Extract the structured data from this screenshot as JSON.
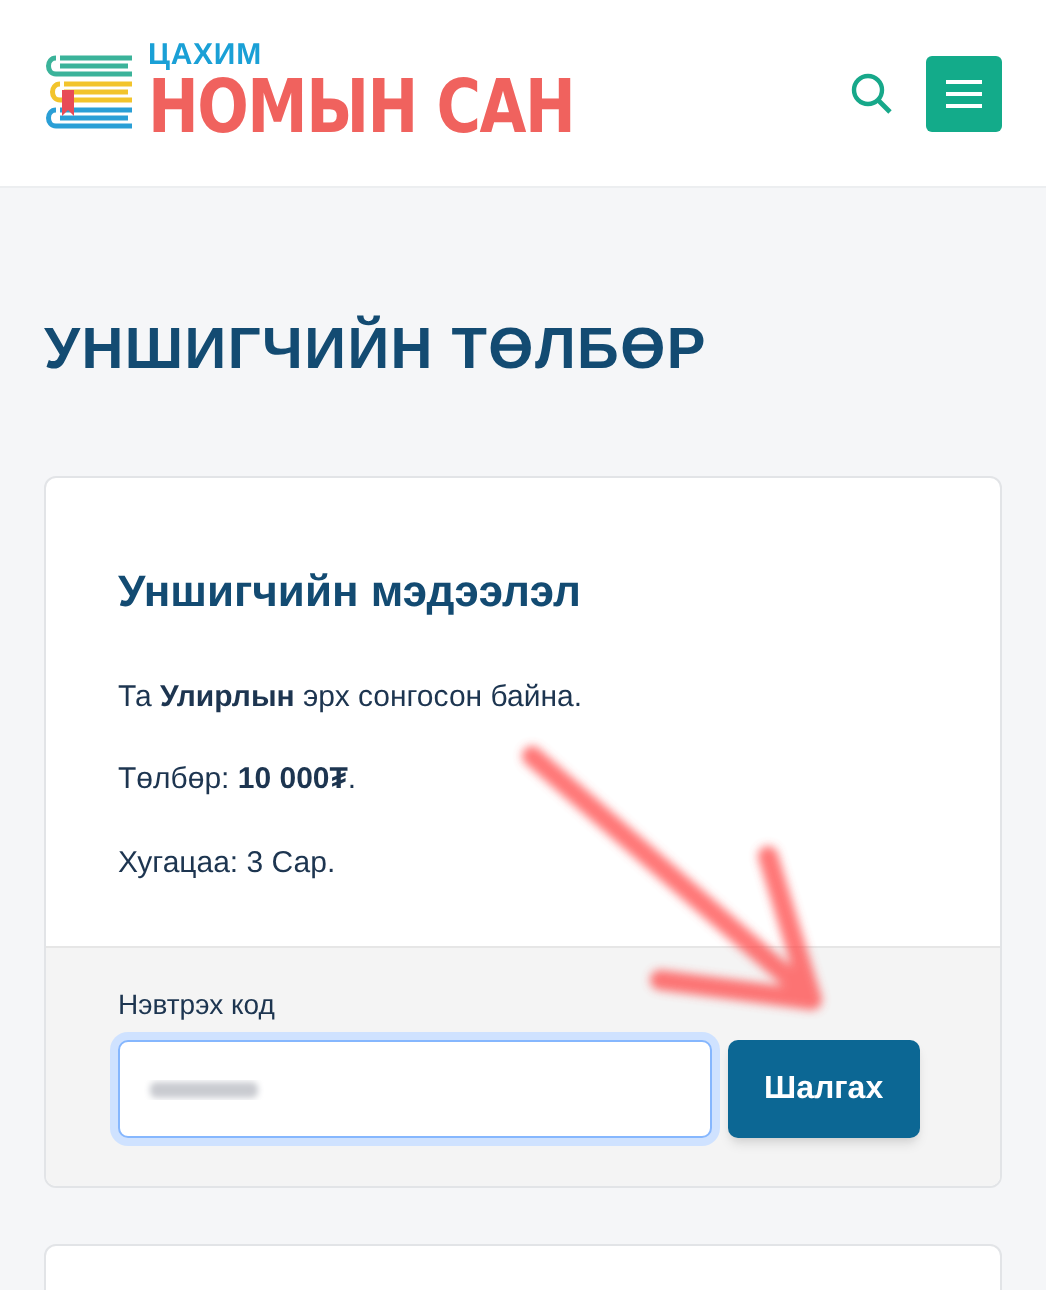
{
  "header": {
    "logo_top": "ЦАХИМ",
    "logo_main": "НОМЫН САН"
  },
  "page_title": "УНШИГЧИЙН ТӨЛБӨР",
  "card": {
    "title": "Уншигчийн мэдээлэл",
    "lines": [
      "Та **Улирлын** эрх сонгосон байна.",
      "Төлбөр: **10 000₮**.",
      "Хугацаа: 3 Сар."
    ],
    "field": {
      "label": "Нэвтрэх код",
      "focused": true
    },
    "button": "Шалгах"
  }
}
